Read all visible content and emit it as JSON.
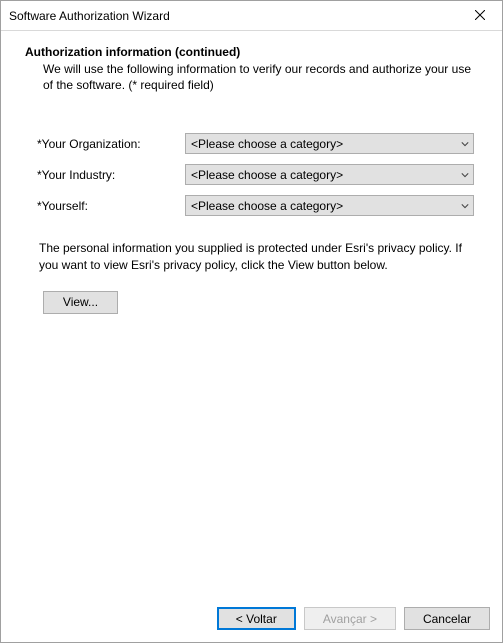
{
  "title": "Software Authorization Wizard",
  "header": {
    "heading": "Authorization information (continued)",
    "description": "We will use the following information to verify our records and authorize your use of the software. (* required field)"
  },
  "form": {
    "rows": [
      {
        "label": "*Your Organization:",
        "value": "<Please choose a category>"
      },
      {
        "label": "*Your Industry:",
        "value": "<Please choose a category>"
      },
      {
        "label": "*Yourself:",
        "value": "<Please choose a category>"
      }
    ],
    "privacy": "The personal information you supplied is protected under Esri's privacy policy. If you want to view Esri's privacy policy, click the View button below.",
    "view_label": "View..."
  },
  "footer": {
    "back": "< Voltar",
    "next": "Avançar >",
    "cancel": "Cancelar"
  }
}
